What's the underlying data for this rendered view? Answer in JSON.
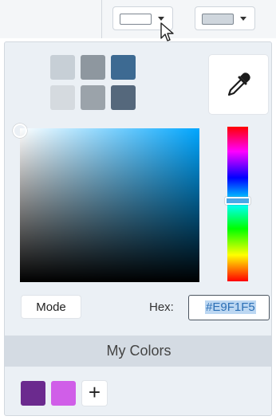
{
  "toolbar": {
    "fill_dropdown": {
      "icon": "rectangle-outline-icon",
      "swatch_color": "#ffffff"
    },
    "line_dropdown": {
      "icon": "rectangle-fill-icon",
      "swatch_color": "#cfd6dd"
    }
  },
  "color_picker": {
    "preset_swatches": [
      "#c7cfd6",
      "#8e979f",
      "#3d6a92",
      "#d5dadf",
      "#9ba3aa",
      "#55687c"
    ],
    "eyedropper": {
      "icon": "eyedropper-icon"
    },
    "hue_color": "#00a6ff",
    "mode_label": "Mode",
    "hex_label": "Hex:",
    "hex_value": "#E9F1F5"
  },
  "my_colors": {
    "title": "My Colors",
    "swatches": [
      "#6b2a8e",
      "#d05ee8"
    ],
    "add_label": "+"
  }
}
